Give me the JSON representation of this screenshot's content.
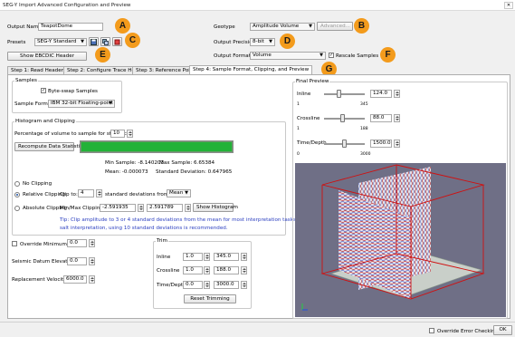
{
  "window": {
    "title": "SEG-Y Import Advanced Configuration and Preview",
    "close_label": "✕"
  },
  "header": {
    "output_name_label": "Output Name",
    "output_name_value": "TeapotDome",
    "presets_label": "Presets",
    "presets_value": "SEG-Y Standard",
    "show_ebcdic_label": "Show EBCDIC Header",
    "geotype_label": "Geotype",
    "geotype_value": "Amplitude Volume",
    "advanced_label": "Advanced...",
    "output_precision_label": "Output Precision",
    "output_precision_value": "8-bit",
    "output_format_label": "Output Format",
    "output_format_value": "Volume",
    "rescale_label": "Rescale Samples",
    "rescale_checked": "✓"
  },
  "markers": {
    "a": "A",
    "b": "B",
    "c": "C",
    "d": "D",
    "e": "E",
    "f": "F",
    "g": "G"
  },
  "tabs": [
    {
      "label": "Step 1: Read Headers"
    },
    {
      "label": "Step 2: Configure Trace Headers"
    },
    {
      "label": "Step 3: Reference Points"
    },
    {
      "label": "Step 4: Sample Format, Clipping, and Preview"
    }
  ],
  "samples": {
    "group_title": "Samples",
    "byte_swap_label": "Byte-swap Samples",
    "byte_swap_checked": "✓",
    "sample_format_label": "Sample Format",
    "sample_format_value": "IBM 32-bit Floating-point"
  },
  "histogram": {
    "group_title": "Histogram and Clipping",
    "percentage_label": "Percentage of volume to sample for statistics:",
    "percentage_value": "10",
    "recompute_label": "Recompute Data Statistics",
    "progress": 1.0,
    "min_sample_label": "Min Sample: -8.140203",
    "max_sample_label": "Max Sample: 6.65384",
    "mean_label": "Mean: -0.000073",
    "stddev_label": "Standard Deviation: 0.647965",
    "no_clipping_label": "No Clipping",
    "relative_clipping_label": "Relative Clipping",
    "clip_to_label": "Clip to:",
    "clip_to_value": "4",
    "std_from_label": "standard deviations from the:",
    "std_from_value": "Mean",
    "absolute_clipping_label": "Absolute Clipping",
    "min_max_label": "Min/Max Clipping:",
    "min_value": "-2.591935",
    "max_value": "2.591789",
    "show_histogram_label": "Show Histogram",
    "tip_line1": "Tip: Clip amplitude to 3 or 4 standard deviations from the mean for most interpretation tasks. For",
    "tip_line2": "salt interpretation, using 10 standard deviations is recommended."
  },
  "bottom_left": {
    "override_min_z_label": "Override Minimum Z",
    "override_min_z_value": "0.0",
    "seismic_datum_label": "Seismic Datum Elevation",
    "seismic_datum_value": "0.0",
    "replacement_velocity_label": "Replacement Velocity",
    "replacement_velocity_value": "6000.0"
  },
  "trim": {
    "group_title": "Trim",
    "inline_label": "Inline",
    "inline_min": "1.0",
    "inline_max": "345.0",
    "crossline_label": "Crossline",
    "crossline_min": "1.0",
    "crossline_max": "188.0",
    "timedepth_label": "Time/Depth",
    "timedepth_min": "0.0",
    "timedepth_max": "3000.0",
    "reset_label": "Reset Trimming"
  },
  "preview": {
    "group_title": "Final Preview",
    "inline_label": "Inline",
    "inline_value": "124.0",
    "inline_min": "1",
    "inline_max": "345",
    "inline_level": 0.36,
    "crossline_label": "Crossline",
    "crossline_value": "88.0",
    "crossline_min": "1",
    "crossline_max": "188",
    "crossline_level": 0.46,
    "timedepth_label": "Time/Depth",
    "timedepth_value": "1500.0",
    "timedepth_min": "0",
    "timedepth_max": "3000",
    "timedepth_level": 0.5
  },
  "status": {
    "override_error_label": "Override Error Checking",
    "ok_label": "OK"
  },
  "colors": {
    "marker": "#f39b1c",
    "progress": "#22b238",
    "viewport_bg": "#6f6f86",
    "bbox": "#d01010"
  }
}
